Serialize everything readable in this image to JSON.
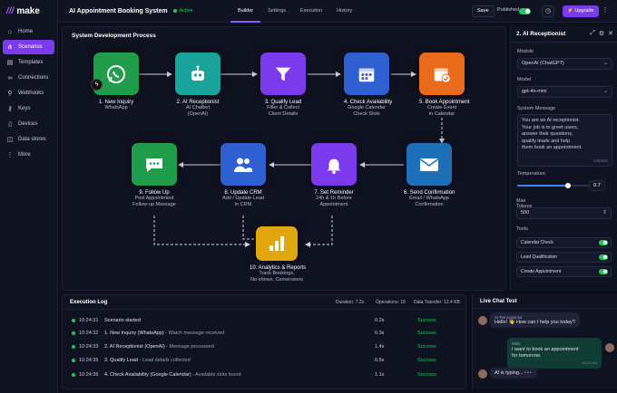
{
  "app": {
    "logo_text": "make",
    "title": "AI Appointment Booking System",
    "status": "Active"
  },
  "sidebar": {
    "items": [
      {
        "label": "Home",
        "icon": "home-icon"
      },
      {
        "label": "Scenarios",
        "icon": "share-icon",
        "active": true
      },
      {
        "label": "Templates",
        "icon": "template-icon"
      },
      {
        "label": "Connections",
        "icon": "link-icon"
      },
      {
        "label": "Webhooks",
        "icon": "webhook-icon"
      },
      {
        "label": "Keys",
        "icon": "key-icon"
      },
      {
        "label": "Devices",
        "icon": "device-icon"
      },
      {
        "label": "Data stores",
        "icon": "database-icon"
      },
      {
        "label": "More",
        "icon": "more-icon"
      }
    ]
  },
  "tabs": [
    {
      "label": "Builder",
      "active": true
    },
    {
      "label": "Settings"
    },
    {
      "label": "Execution"
    },
    {
      "label": "History"
    }
  ],
  "toolbar": {
    "save_label": "Save",
    "published_label": "Published",
    "upgrade_label": "Upgrade"
  },
  "canvas": {
    "title": "System Development Process",
    "nodes": [
      {
        "title": "1. New Inquiry",
        "sub1": "WhatsApp",
        "sub2": "",
        "icon": "whatsapp-icon",
        "color": "#1f9d4a"
      },
      {
        "title": "2. AI Receptionist",
        "sub1": "AI Chatbot",
        "sub2": "(OpenAI)",
        "icon": "robot-icon",
        "color": "#1aa39a"
      },
      {
        "title": "3. Qualify Lead",
        "sub1": "Filter & Collect",
        "sub2": "Client Details",
        "icon": "filter-icon",
        "color": "#7c3aed"
      },
      {
        "title": "4. Check Availability",
        "sub1": "Google Calendar",
        "sub2": "Check Slots",
        "icon": "calendar-icon",
        "color": "#2f5fd0"
      },
      {
        "title": "5. Book Appointment",
        "sub1": "Create Event",
        "sub2": "in Calendar",
        "icon": "calendar-check-icon",
        "color": "#ea6a1c"
      },
      {
        "title": "6. Send Confirmation",
        "sub1": "Email / WhatsApp",
        "sub2": "Confirmation",
        "icon": "mail-icon",
        "color": "#1d6fb8"
      },
      {
        "title": "7. Set Reminder",
        "sub1": "24h & 1h Before",
        "sub2": "Appointment",
        "icon": "bell-icon",
        "color": "#7c3aed"
      },
      {
        "title": "8. Update CRM",
        "sub1": "Add / Update Lead",
        "sub2": "in CRM",
        "icon": "users-icon",
        "color": "#2f5fd0"
      },
      {
        "title": "9. Follow Up",
        "sub1": "Post Appointment",
        "sub2": "Follow-up Message",
        "icon": "chat-icon",
        "color": "#1f9d4a"
      },
      {
        "title": "10. Analytics & Reports",
        "sub1": "Track Bookings,",
        "sub2": "No-shows, Conversions",
        "icon": "bar-chart-icon",
        "color": "#e0a80e"
      }
    ]
  },
  "panel": {
    "title": "2. AI Receptionist",
    "module_label": "Module",
    "module_value": "OpenAI (ChatGPT)",
    "model_label": "Model",
    "model_value": "gpt-4o-mini",
    "system_message_label": "System Message",
    "system_message_lines": [
      "You are an AI receptionist.",
      "Your job is to greet users,",
      "answer their questions,",
      "qualify leads and help",
      "them book an appointment."
    ],
    "char_count": "136/500",
    "temperature_label": "Temperature",
    "temperature_value": "0.7",
    "temperature_fraction": 0.7,
    "max_tokens_label": "Max Tokens",
    "max_tokens_value": "500",
    "tools_label": "Tools",
    "tools": [
      {
        "label": "Calendar Check",
        "enabled": true
      },
      {
        "label": "Lead Qualification",
        "enabled": true
      },
      {
        "label": "Create Appointment",
        "enabled": true
      }
    ]
  },
  "exec_log": {
    "title": "Execution Log",
    "duration": "Duration: 7.2s",
    "operations": "Operations: 18",
    "transfer": "Data Transfer: 12.4 KB",
    "rows": [
      {
        "time": "10:24:31",
        "step": "Scenario started",
        "msg": "",
        "dur": "0.2s",
        "status": "Success"
      },
      {
        "time": "10:24:32",
        "step": "1. New Inquiry (WhatsApp)",
        "msg": " - Watch message received",
        "dur": "0.3s",
        "status": "Success"
      },
      {
        "time": "10:24:33",
        "step": "2. AI Receptionist (OpenAI)",
        "msg": " - Message processed",
        "dur": "1.4s",
        "status": "Success"
      },
      {
        "time": "10:24:35",
        "step": "3. Qualify Lead",
        "msg": " - Lead details collected",
        "dur": "0.6s",
        "status": "Success"
      },
      {
        "time": "10:24:36",
        "step": "4. Check Availability (Google Calendar)",
        "msg": " - Available slots found",
        "dur": "1.1s",
        "status": "Success"
      }
    ]
  },
  "chat": {
    "title": "Live Chat Test",
    "bot_name": "AI Receptionist",
    "bot_msg": "Hello! 👋 How can I help you today?",
    "user_name": "Mike",
    "user_msg_1": "I want to book an appointment",
    "user_msg_2": "for tomorrow.",
    "user_time": "10:24 AM",
    "typing": "AI is typing..."
  }
}
